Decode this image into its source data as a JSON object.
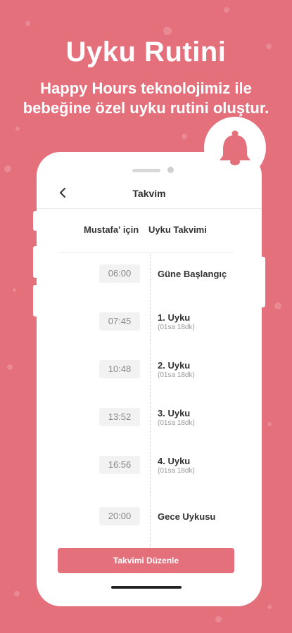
{
  "headline": "Uyku Rutini",
  "subline_1": "Happy Hours teknolojimiz ile",
  "subline_2": "bebeğine özel uyku rutini oluştur.",
  "colors": {
    "brand": "#e4707c",
    "text": "#333333",
    "muted": "#999999",
    "chip_bg": "#f2f2f2"
  },
  "bell_icon": "bell-icon",
  "app": {
    "title": "Takvim",
    "back_icon": "chevron-left-icon",
    "calendar_heading_left": "Mustafa' için",
    "calendar_heading_right": "Uyku Takvimi",
    "events": [
      {
        "time": "06:00",
        "title": "Güne Başlangıç",
        "sub": ""
      },
      {
        "time": "07:45",
        "title": "1. Uyku",
        "sub": "(01sa 18dk)"
      },
      {
        "time": "10:48",
        "title": "2. Uyku",
        "sub": "(01sa 18dk)"
      },
      {
        "time": "13:52",
        "title": "3. Uyku",
        "sub": "(01sa 18dk)"
      },
      {
        "time": "16:56",
        "title": "4. Uyku",
        "sub": "(01sa 18dk)"
      },
      {
        "time": "20:00",
        "title": "Gece Uykusu",
        "sub": ""
      }
    ],
    "edit_button_label": "Takvimi Düzenle"
  }
}
